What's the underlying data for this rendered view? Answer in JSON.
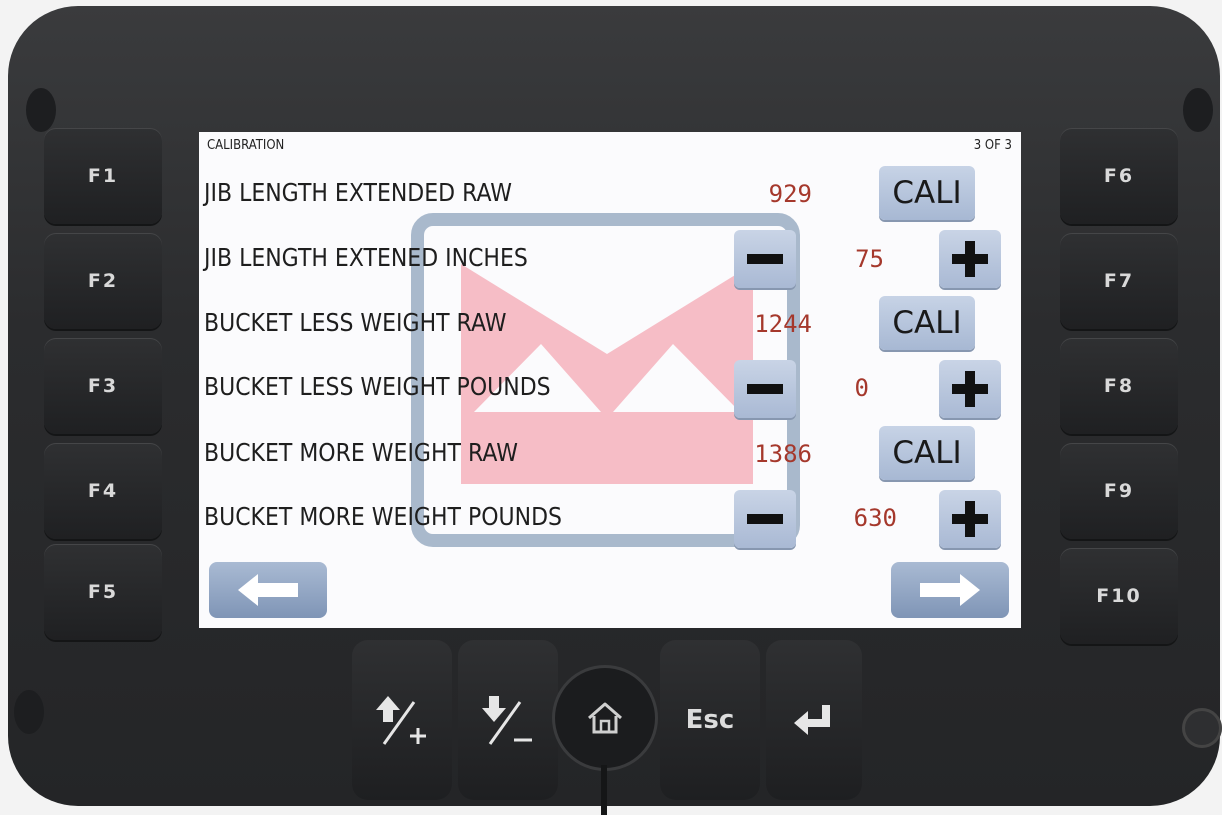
{
  "screen": {
    "title": "CALIBRATION",
    "page_indicator": "3 OF 3",
    "rows": [
      {
        "label": "JIB LENGTH EXTENDED RAW",
        "value": "929",
        "control": "cali"
      },
      {
        "label": "JIB LENGTH EXTENED INCHES",
        "value": "75",
        "control": "stepper"
      },
      {
        "label": "BUCKET LESS WEIGHT RAW",
        "value": "1244",
        "control": "cali"
      },
      {
        "label": "BUCKET LESS WEIGHT POUNDS",
        "value": "0",
        "control": "stepper"
      },
      {
        "label": "BUCKET MORE WEIGHT RAW",
        "value": "1386",
        "control": "cali"
      },
      {
        "label": "BUCKET MORE WEIGHT POUNDS",
        "value": "630",
        "control": "stepper"
      }
    ],
    "cali_label": "CALI",
    "nav": {
      "back_icon": "arrow-left-icon",
      "next_icon": "arrow-right-icon"
    },
    "watermark_colors": {
      "frame": "#a9b9cc",
      "crown": "#f5b9c3"
    }
  },
  "device": {
    "left_keys": [
      "F1",
      "F2",
      "F3",
      "F4",
      "F5"
    ],
    "right_keys": [
      "F6",
      "F7",
      "F8",
      "F9",
      "F10"
    ],
    "bottom_keys": {
      "up_icon": "up-plus-icon",
      "down_icon": "down-minus-icon",
      "home_icon": "home-icon",
      "esc_label": "Esc",
      "enter_icon": "enter-icon"
    }
  },
  "colors": {
    "value_red": "#a5382c",
    "button_blue": "#b2c1da",
    "housing": "#2b2c2e"
  }
}
